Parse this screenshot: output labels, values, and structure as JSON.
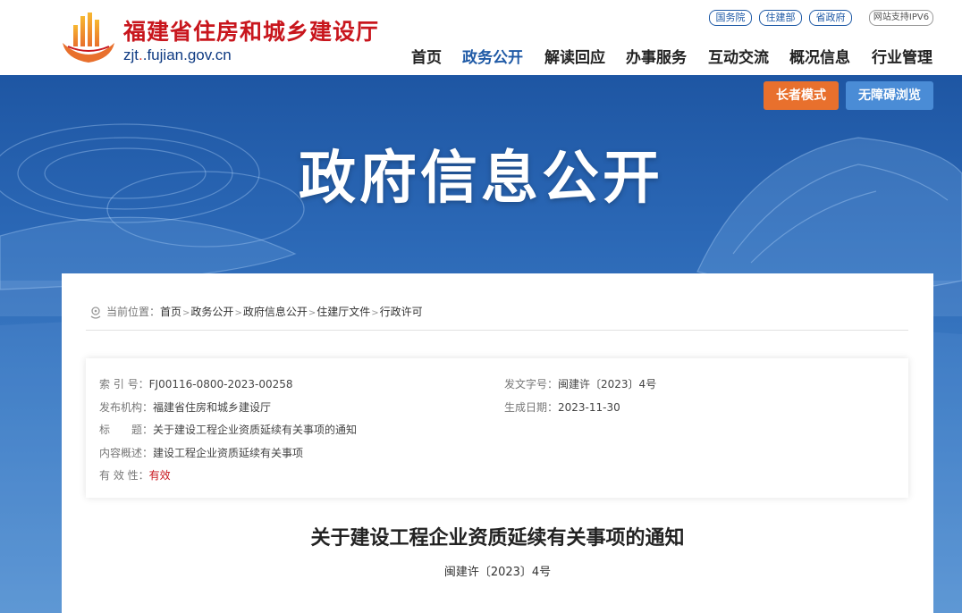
{
  "header": {
    "site_title": "福建省住房和城乡建设厅",
    "domain_prefix": "zjt",
    "domain_rest": ".fujian.gov.cn",
    "top_links": [
      "国务院",
      "住建部",
      "省政府"
    ],
    "ipv6": "网站支持IPV6",
    "nav": [
      "首页",
      "政务公开",
      "解读回应",
      "办事服务",
      "互动交流",
      "概况信息",
      "行业管理"
    ],
    "nav_active": "政务公开"
  },
  "banner": {
    "title": "政府信息公开",
    "elder_mode": "长者模式",
    "accessible": "无障碍浏览"
  },
  "breadcrumb": {
    "label": "当前位置：",
    "items": [
      "首页",
      "政务公开",
      "政府信息公开",
      "住建厅文件",
      "行政许可"
    ]
  },
  "meta": {
    "index_key": "索 引 号：",
    "index_val": "FJ00116-0800-2023-00258",
    "doc_no_key": "发文字号：",
    "doc_no_val": "闽建许〔2023〕4号",
    "publisher_key": "发布机构：",
    "publisher_val": "福建省住房和城乡建设厅",
    "date_key": "生成日期：",
    "date_val": "2023-11-30",
    "title_key": "标　　题：",
    "title_val": "关于建设工程企业资质延续有关事项的通知",
    "summary_key": "内容概述：",
    "summary_val": "建设工程企业资质延续有关事项",
    "validity_key": "有 效 性：",
    "validity_val": "有效"
  },
  "document": {
    "title": "关于建设工程企业资质延续有关事项的通知",
    "number": "闽建许〔2023〕4号"
  },
  "colors": {
    "brand_red": "#c8161d",
    "brand_blue": "#1f5aa6",
    "elder_orange": "#e8702d"
  }
}
